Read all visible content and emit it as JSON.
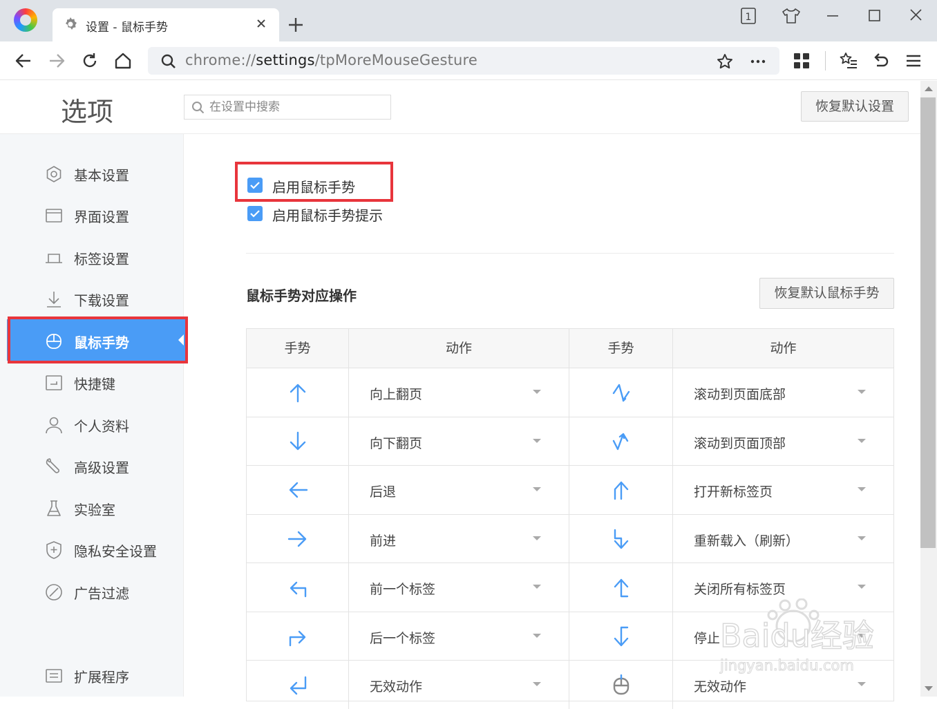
{
  "browser": {
    "tab_title": "设置 - 鼠标手势",
    "tab_count": "1",
    "url_prefix": "chrome://",
    "url_host": "settings",
    "url_path": "/tpMoreMouseGesture"
  },
  "header": {
    "title": "选项",
    "search_placeholder": "在设置中搜索",
    "reset_all_label": "恢复默认设置"
  },
  "sidebar": {
    "items": [
      {
        "label": "基本设置",
        "icon": "gear-hex-icon"
      },
      {
        "label": "界面设置",
        "icon": "window-icon"
      },
      {
        "label": "标签设置",
        "icon": "tab-icon"
      },
      {
        "label": "下载设置",
        "icon": "download-icon"
      },
      {
        "label": "鼠标手势",
        "icon": "mouse-icon",
        "active": true
      },
      {
        "label": "快捷键",
        "icon": "keyboard-icon"
      },
      {
        "label": "个人资料",
        "icon": "user-icon"
      },
      {
        "label": "高级设置",
        "icon": "wrench-icon"
      },
      {
        "label": "实验室",
        "icon": "flask-icon"
      },
      {
        "label": "隐私安全设置",
        "icon": "shield-icon"
      },
      {
        "label": "广告过滤",
        "icon": "block-icon"
      }
    ],
    "extensions_label": "扩展程序"
  },
  "gestures": {
    "enable_label": "启用鼠标手势",
    "enable_checked": true,
    "hint_label": "启用鼠标手势提示",
    "hint_checked": true,
    "section_title": "鼠标手势对应操作",
    "reset_label": "恢复默认鼠标手势",
    "columns": [
      "手势",
      "动作",
      "手势",
      "动作"
    ],
    "left_actions": [
      "向上翻页",
      "向下翻页",
      "后退",
      "前进",
      "前一个标签",
      "后一个标签",
      "无效动作"
    ],
    "right_actions": [
      "滚动到页面底部",
      "滚动到页面顶部",
      "打开新标签页",
      "重新载入（刷新）",
      "关闭所有标签页",
      "停止",
      "无效动作"
    ]
  },
  "colors": {
    "accent": "#4a9cf6",
    "highlight": "#e8353c"
  },
  "watermark": {
    "brand": "Baidu经验",
    "domain": "jingyan.baidu.com"
  }
}
